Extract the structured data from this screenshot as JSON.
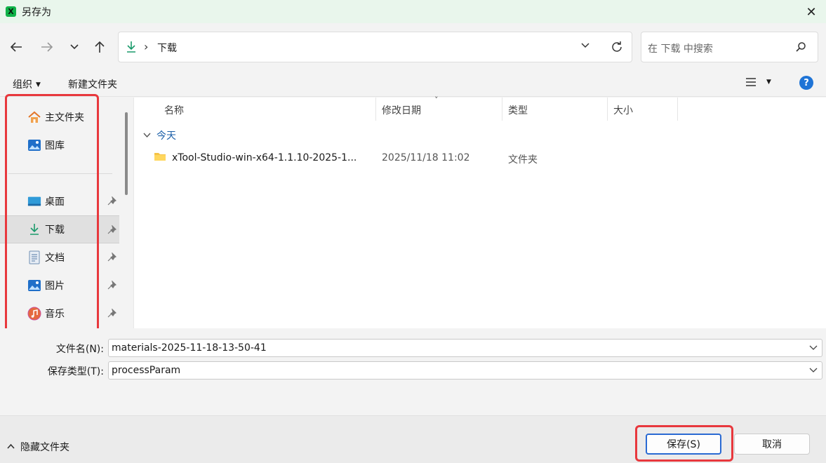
{
  "window": {
    "title": "另存为",
    "app_icon": "X",
    "close": "✕"
  },
  "nav": {
    "back_icon": "arrow-left-icon",
    "forward_icon": "arrow-right-icon",
    "recent_icon": "chevron-down-icon",
    "up_icon": "arrow-up-icon",
    "address": {
      "location": "下载",
      "separator": "›"
    },
    "search_placeholder": "在 下载 中搜索"
  },
  "toolbar": {
    "organize": "组织",
    "new_folder": "新建文件夹",
    "help": "?"
  },
  "sidebar": {
    "items": [
      {
        "label": "主文件夹",
        "icon": "home-icon",
        "pinned": false,
        "active": false
      },
      {
        "label": "图库",
        "icon": "gallery-icon",
        "pinned": false,
        "active": false
      },
      {
        "label": "桌面",
        "icon": "desktop-icon",
        "pinned": true,
        "active": false
      },
      {
        "label": "下载",
        "icon": "download-icon",
        "pinned": true,
        "active": true
      },
      {
        "label": "文档",
        "icon": "document-icon",
        "pinned": true,
        "active": false
      },
      {
        "label": "图片",
        "icon": "pictures-icon",
        "pinned": true,
        "active": false
      },
      {
        "label": "音乐",
        "icon": "music-icon",
        "pinned": true,
        "active": false
      }
    ]
  },
  "file_list": {
    "columns": [
      "名称",
      "修改日期",
      "类型",
      "大小"
    ],
    "sort_indicator": "˅",
    "group_label": "今天",
    "rows": [
      {
        "name": "xTool-Studio-win-x64-1.1.10-2025-1...",
        "modified": "2025/11/18 11:02",
        "type": "文件夹",
        "size": ""
      }
    ]
  },
  "form": {
    "filename_label": "文件名(N):",
    "filename_value": "materials-2025-11-18-13-50-41",
    "filetype_label": "保存类型(T):",
    "filetype_value": "processParam"
  },
  "footer": {
    "hide_folders": "隐藏文件夹",
    "save": "保存(S)",
    "cancel": "取消"
  },
  "colors": {
    "accent": "#1f74d6",
    "highlight_box": "#e8383d",
    "title_bg": "#e9f6ec",
    "download_green": "#1a9a6b"
  }
}
